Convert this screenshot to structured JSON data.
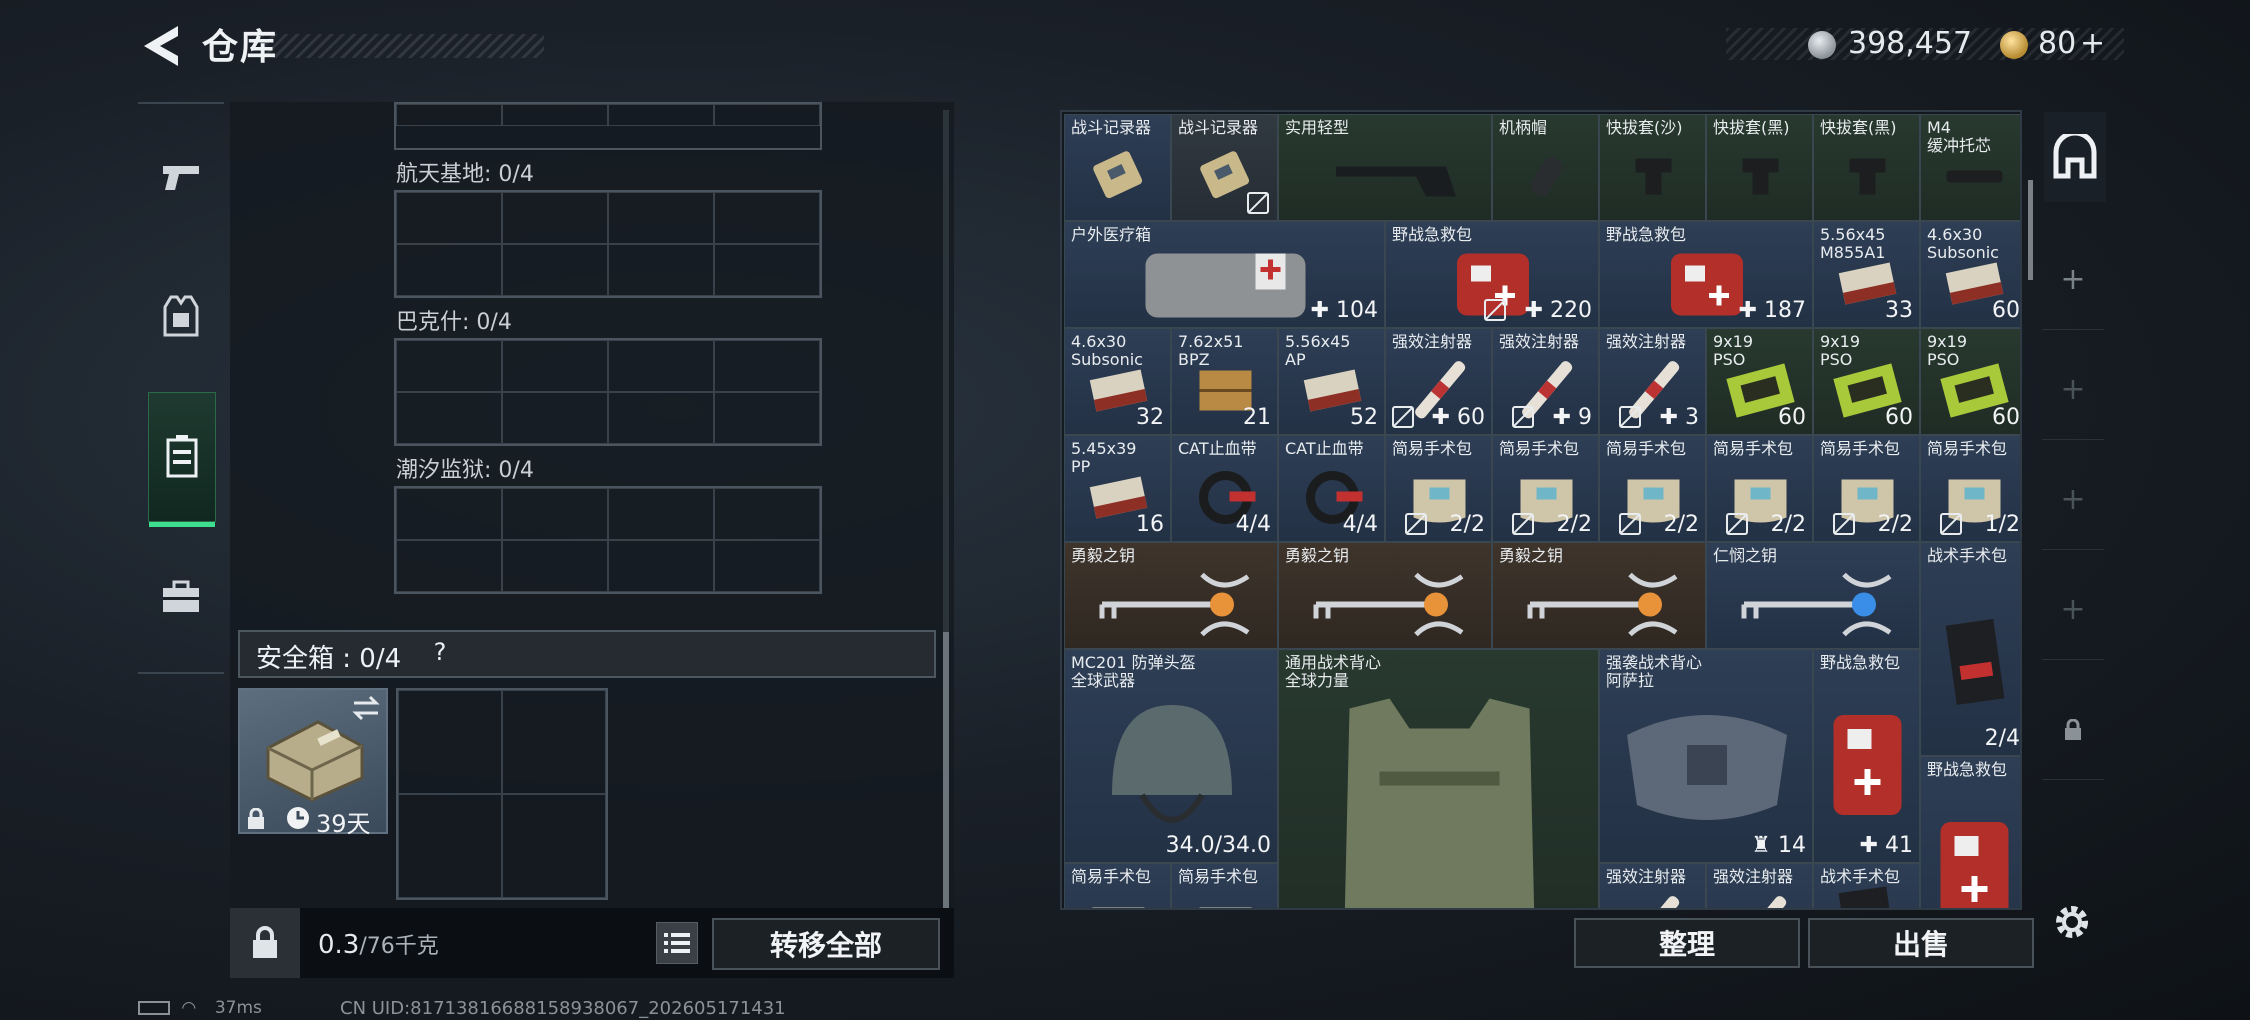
{
  "header": {
    "title": "仓库"
  },
  "currency": {
    "silver": "398,457",
    "gold": "80",
    "gold_plus": "+"
  },
  "regions": [
    {
      "label": "航天基地: 0/4"
    },
    {
      "label": "巴克什: 0/4"
    },
    {
      "label": "潮汐监狱: 0/4"
    }
  ],
  "safe_box": {
    "label": "安全箱 : 0/4",
    "help": "?",
    "days": "39天"
  },
  "weight": {
    "current": "0.3",
    "max": "/76千克"
  },
  "buttons": {
    "transfer_all": "转移全部",
    "arrange": "整理",
    "sell": "出售"
  },
  "status": {
    "ping": "37ms",
    "uid": "CN UID:8171381668815893806​7_202605171431"
  },
  "inventory": [
    {
      "name": "战斗记录器",
      "qty": ""
    },
    {
      "name": "战斗记录器",
      "qty": "",
      "no_trade": true
    },
    {
      "name": "实用轻型",
      "qty": ""
    },
    {
      "name": "机柄帽",
      "qty": ""
    },
    {
      "name": "快拔套(沙)",
      "qty": ""
    },
    {
      "name": "快拔套(黑)",
      "qty": ""
    },
    {
      "name": "快拔套(黑)",
      "qty": ""
    },
    {
      "name": "M4\n缓冲托芯",
      "qty": ""
    },
    {
      "name": "户外医疗箱",
      "qty": "✚ 104"
    },
    {
      "name": "野战急救包",
      "qty": "✚ 220",
      "no_trade": true
    },
    {
      "name": "野战急救包",
      "qty": "✚ 187"
    },
    {
      "name": "5.56x45\nM855A1",
      "qty": "33"
    },
    {
      "name": "4.6x30\nSubsonic",
      "qty": "60"
    },
    {
      "name": "4.6x30\nSubsonic",
      "qty": "32"
    },
    {
      "name": "7.62x51\nBPZ",
      "qty": "21"
    },
    {
      "name": "5.56x45\nAP",
      "qty": "52"
    },
    {
      "name": "强效注射器",
      "qty": "✚ 60",
      "no_trade": true
    },
    {
      "name": "强效注射器",
      "qty": "✚ 9",
      "no_trade": true
    },
    {
      "name": "强效注射器",
      "qty": "✚ 3",
      "no_trade": true
    },
    {
      "name": "9x19\nPSO",
      "qty": "60"
    },
    {
      "name": "9x19\nPSO",
      "qty": "60"
    },
    {
      "name": "9x19\nPSO",
      "qty": "60"
    },
    {
      "name": "5.45x39\nPP",
      "qty": "16"
    },
    {
      "name": "CAT止血带",
      "qty": "4/4"
    },
    {
      "name": "CAT止血带",
      "qty": "4/4"
    },
    {
      "name": "简易手术包",
      "qty": "2/2",
      "no_trade": true
    },
    {
      "name": "简易手术包",
      "qty": "2/2",
      "no_trade": true
    },
    {
      "name": "简易手术包",
      "qty": "2/2",
      "no_trade": true
    },
    {
      "name": "简易手术包",
      "qty": "2/2",
      "no_trade": true
    },
    {
      "name": "简易手术包",
      "qty": "2/2",
      "no_trade": true
    },
    {
      "name": "简易手术包",
      "qty": "1/2",
      "no_trade": true
    },
    {
      "name": "勇毅之钥",
      "qty": ""
    },
    {
      "name": "勇毅之钥",
      "qty": ""
    },
    {
      "name": "勇毅之钥",
      "qty": ""
    },
    {
      "name": "仁悯之钥",
      "qty": ""
    },
    {
      "name": "战术手术包",
      "qty": "2/4"
    },
    {
      "name": "MC201 防弹头盔\n全球武器",
      "qty": "34.0/34.0"
    },
    {
      "name": "通用战术背心\n全球力量",
      "qty": ""
    },
    {
      "name": "强袭战术背心\n阿萨拉",
      "qty": "♜ 14"
    },
    {
      "name": "野战急救包",
      "qty": "✚ 41"
    },
    {
      "name": "野战急救包",
      "qty": ""
    },
    {
      "name": "简易手术包",
      "qty": ""
    },
    {
      "name": "简易手术包",
      "qty": ""
    },
    {
      "name": "强效注射器",
      "qty": ""
    },
    {
      "name": "强效注射器",
      "qty": ""
    },
    {
      "name": "战术手术包",
      "qty": ""
    }
  ],
  "right_sidebar": {
    "plus_label": "+"
  }
}
